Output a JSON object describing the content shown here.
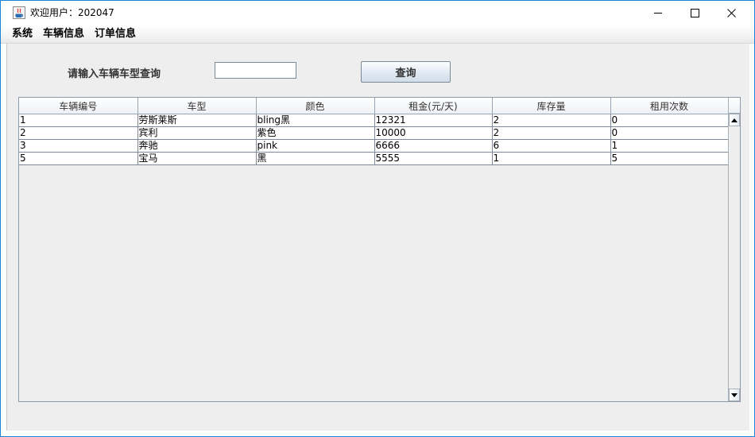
{
  "window": {
    "title": "欢迎用户：202047",
    "icon": "java-icon"
  },
  "menu": {
    "items": [
      {
        "label": "系统"
      },
      {
        "label": "车辆信息"
      },
      {
        "label": "订单信息"
      }
    ]
  },
  "search": {
    "label": "请输入车辆车型查询",
    "value": "",
    "button_label": "查询"
  },
  "table": {
    "columns": [
      "车辆编号",
      "车型",
      "颜色",
      "租金(元/天)",
      "库存量",
      "租用次数"
    ],
    "rows": [
      [
        "1",
        "劳斯莱斯",
        "bling黑",
        "12321",
        "2",
        "0"
      ],
      [
        "2",
        "宾利",
        "紫色",
        "10000",
        "2",
        "0"
      ],
      [
        "3",
        "奔驰",
        "pink",
        "6666",
        "6",
        "1"
      ],
      [
        "5",
        "宝马",
        "黑",
        "5555",
        "1",
        "5"
      ]
    ]
  },
  "colors": {
    "window_border": "#1883d7",
    "content_background": "#eeeeee"
  }
}
